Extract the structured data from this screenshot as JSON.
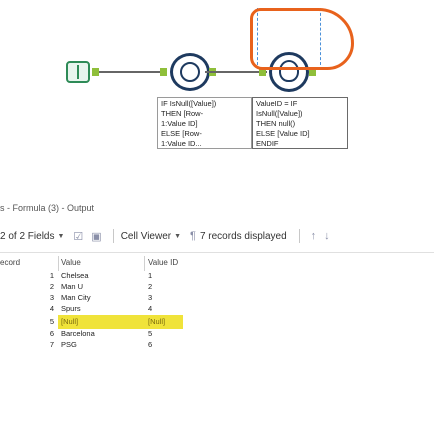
{
  "workflow": {
    "annotations": {
      "left": [
        "IF IsNull([Value])",
        "THEN [Row-",
        "1:Value ID]",
        "ELSE [Row-",
        "1:Value ID..."
      ],
      "right": [
        "ValueID = IF",
        "IsNull([Value])",
        "THEN null()",
        "ELSE [Value ID]",
        "ENDIF"
      ]
    }
  },
  "results": {
    "title": "s - Formula (3) - Output",
    "toolbar": {
      "fields": "2 of 2 Fields",
      "cell_viewer": "Cell Viewer",
      "records_displayed": "7 records displayed"
    },
    "columns": {
      "record": "ecord",
      "value": "Value",
      "value_id": "Value ID"
    },
    "rows": [
      {
        "num": "1",
        "value": "Chelsea",
        "value_id": "1"
      },
      {
        "num": "2",
        "value": "Man U",
        "value_id": "2"
      },
      {
        "num": "3",
        "value": "Man City",
        "value_id": "3"
      },
      {
        "num": "4",
        "value": "Spurs",
        "value_id": "4"
      },
      {
        "num": "5",
        "value": "[Null]",
        "value_id": "[Null]"
      },
      {
        "num": "6",
        "value": "Barcelona",
        "value_id": "5"
      },
      {
        "num": "7",
        "value": "PSG",
        "value_id": "6"
      }
    ]
  },
  "colors": {
    "highlight_ring": "#e8621c",
    "null_highlight": "#f0e33a",
    "tool_navy": "#1e3a5f",
    "anchor_green": "#8fbf3a"
  }
}
